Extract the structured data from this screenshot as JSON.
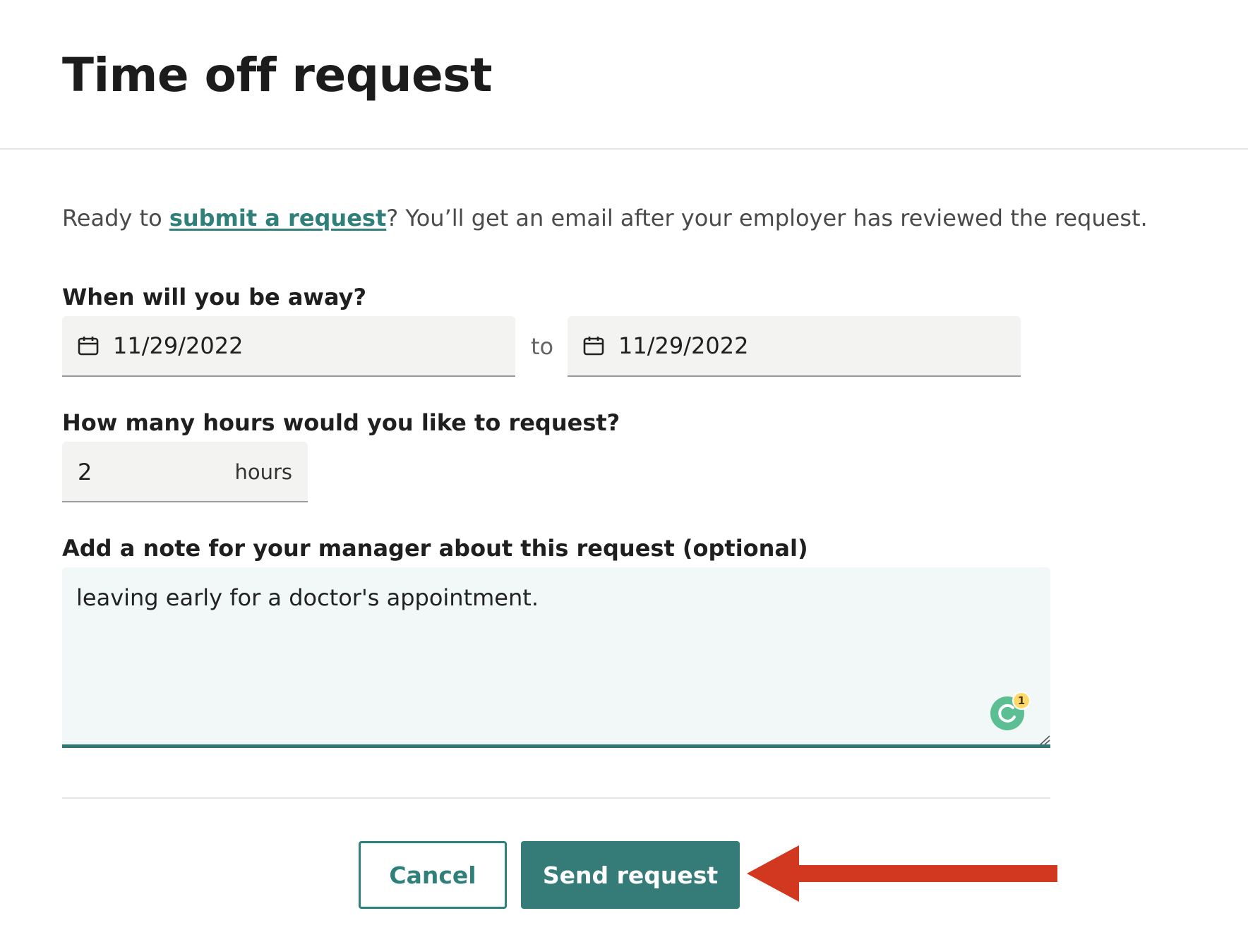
{
  "header": {
    "title": "Time off request"
  },
  "intro": {
    "prefix": "Ready to ",
    "link": "submit a request",
    "suffix": "? You’ll get an email after your employer has reviewed the request."
  },
  "dates": {
    "label": "When will you be away?",
    "start": "11/29/2022",
    "separator": "to",
    "end": "11/29/2022",
    "icon": "calendar-icon"
  },
  "hours": {
    "label": "How many hours would you like to request?",
    "value": "2",
    "unit": "hours"
  },
  "note": {
    "label": "Add a note for your manager about this request (optional)",
    "value": "leaving early for a doctor's appointment.",
    "assistant_badge": "1"
  },
  "actions": {
    "cancel": "Cancel",
    "send": "Send request"
  },
  "colors": {
    "accent": "#357c79",
    "link": "#2f7f7a",
    "annotation_arrow": "#d2381f"
  }
}
